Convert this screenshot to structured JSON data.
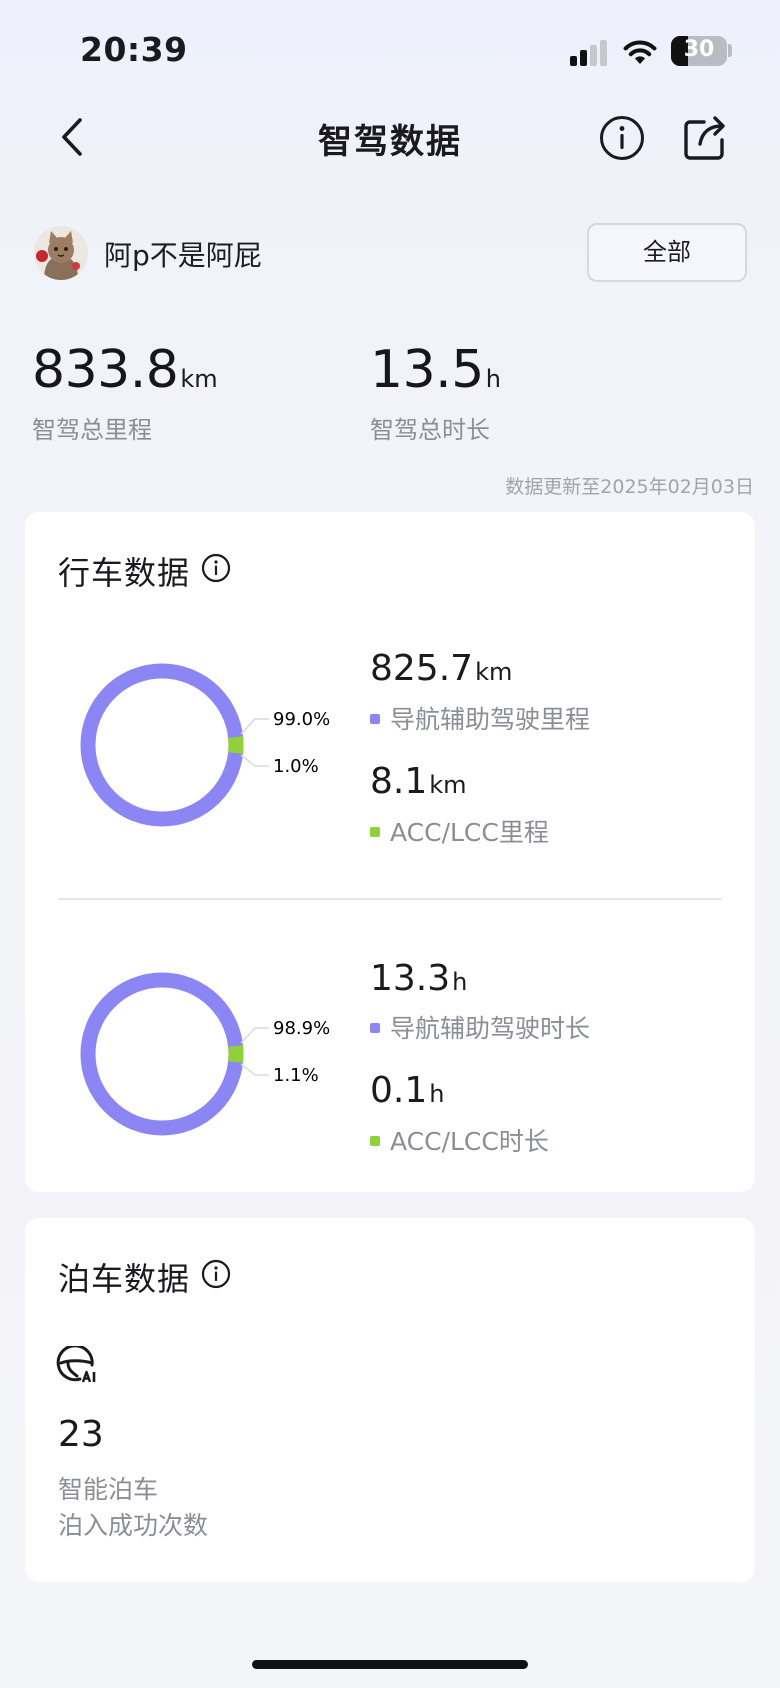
{
  "status_bar": {
    "time": "20:39",
    "battery": "30"
  },
  "nav": {
    "title": "智驾数据"
  },
  "user": {
    "name": "阿p不是阿屁",
    "filter_label": "全部"
  },
  "summary": {
    "distance": {
      "value": "833.8",
      "unit": "km",
      "label": "智驾总里程"
    },
    "duration": {
      "value": "13.5",
      "unit": "h",
      "label": "智驾总时长"
    },
    "update_note": "数据更新至2025年02月03日"
  },
  "colors": {
    "navigation": "#8c86f5",
    "acc_lcc": "#8fd13a"
  },
  "driving": {
    "title": "行车数据",
    "mileage": {
      "nav_pct": "99.0%",
      "acc_pct": "1.0%",
      "acc_fraction": 0.01,
      "nav_value": "825.7",
      "nav_unit": "km",
      "nav_label": "导航辅助驾驶里程",
      "acc_value": "8.1",
      "acc_unit": "km",
      "acc_label": "ACC/LCC里程"
    },
    "time": {
      "nav_pct": "98.9%",
      "acc_pct": "1.1%",
      "acc_fraction": 0.011,
      "nav_value": "13.3",
      "nav_unit": "h",
      "nav_label": "导航辅助驾驶时长",
      "acc_value": "0.1",
      "acc_unit": "h",
      "acc_label": "ACC/LCC时长"
    }
  },
  "parking": {
    "title": "泊车数据",
    "count": "23",
    "label_line1": "智能泊车",
    "label_line2": "泊入成功次数"
  }
}
